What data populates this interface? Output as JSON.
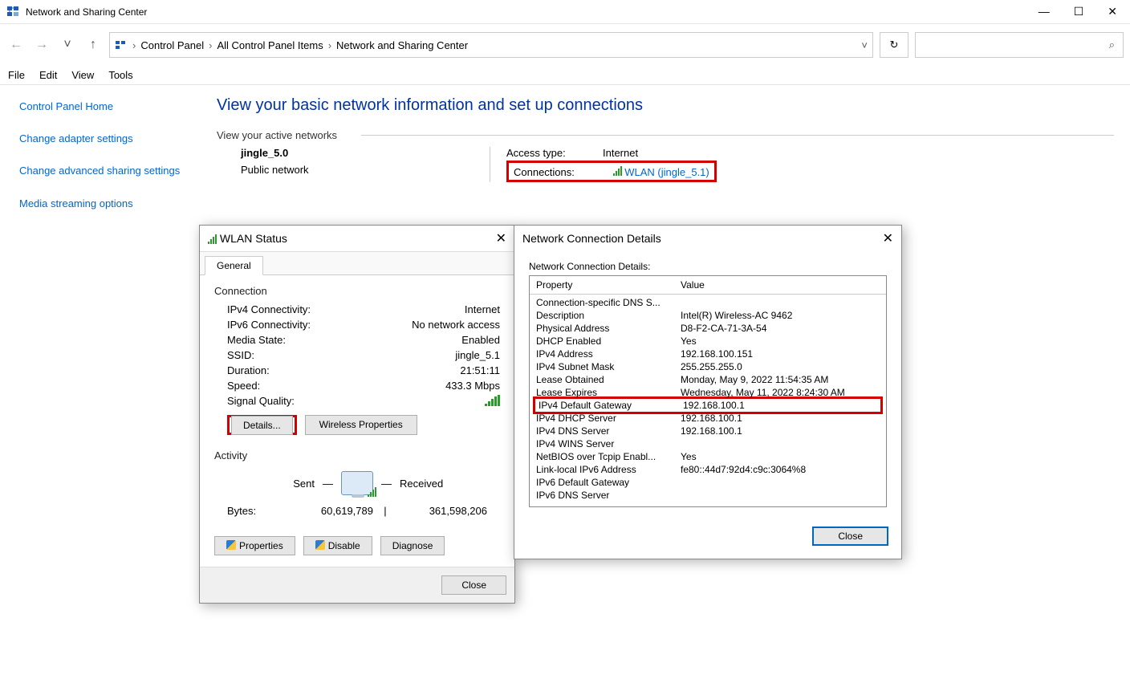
{
  "window": {
    "title": "Network and Sharing Center"
  },
  "breadcrumb": {
    "b1": "Control Panel",
    "b2": "All Control Panel Items",
    "b3": "Network and Sharing Center"
  },
  "menu": {
    "file": "File",
    "edit": "Edit",
    "view": "View",
    "tools": "Tools"
  },
  "sidebar": {
    "home": "Control Panel Home",
    "adapter": "Change adapter settings",
    "sharing": "Change advanced sharing settings",
    "media": "Media streaming options"
  },
  "main": {
    "header": "View your basic network information and set up connections",
    "active_label": "View your active networks",
    "network_name": "jingle_5.0",
    "network_type": "Public network",
    "access_label": "Access type:",
    "access_value": "Internet",
    "conn_label": "Connections:",
    "conn_value": "WLAN (jingle_5.1)"
  },
  "status": {
    "title": "WLAN Status",
    "tab": "General",
    "grp1": "Connection",
    "rows": {
      "ipv4c_k": "IPv4 Connectivity:",
      "ipv4c_v": "Internet",
      "ipv6c_k": "IPv6 Connectivity:",
      "ipv6c_v": "No network access",
      "media_k": "Media State:",
      "media_v": "Enabled",
      "ssid_k": "SSID:",
      "ssid_v": "jingle_5.1",
      "dur_k": "Duration:",
      "dur_v": "21:51:11",
      "speed_k": "Speed:",
      "speed_v": "433.3 Mbps",
      "sq_k": "Signal Quality:"
    },
    "details_btn": "Details...",
    "wprops_btn": "Wireless Properties",
    "grp2": "Activity",
    "sent": "Sent",
    "received": "Received",
    "bytes_k": "Bytes:",
    "bytes_s": "60,619,789",
    "bytes_r": "361,598,206",
    "props": "Properties",
    "disable": "Disable",
    "diag": "Diagnose",
    "close": "Close"
  },
  "details": {
    "title": "Network Connection Details",
    "label": "Network Connection Details:",
    "col1": "Property",
    "col2": "Value",
    "rows": [
      {
        "p": "Connection-specific DNS S...",
        "v": ""
      },
      {
        "p": "Description",
        "v": "Intel(R) Wireless-AC 9462"
      },
      {
        "p": "Physical Address",
        "v": "D8-F2-CA-71-3A-54"
      },
      {
        "p": "DHCP Enabled",
        "v": "Yes"
      },
      {
        "p": "IPv4 Address",
        "v": "192.168.100.151"
      },
      {
        "p": "IPv4 Subnet Mask",
        "v": "255.255.255.0"
      },
      {
        "p": "Lease Obtained",
        "v": "Monday, May 9, 2022 11:54:35 AM"
      },
      {
        "p": "Lease Expires",
        "v": "Wednesday, May 11, 2022 8:24:30 AM"
      },
      {
        "p": "IPv4 Default Gateway",
        "v": "192.168.100.1",
        "hl": true
      },
      {
        "p": "IPv4 DHCP Server",
        "v": "192.168.100.1"
      },
      {
        "p": "IPv4 DNS Server",
        "v": "192.168.100.1"
      },
      {
        "p": "IPv4 WINS Server",
        "v": ""
      },
      {
        "p": "NetBIOS over Tcpip Enabl...",
        "v": "Yes"
      },
      {
        "p": "Link-local IPv6 Address",
        "v": "fe80::44d7:92d4:c9c:3064%8"
      },
      {
        "p": "IPv6 Default Gateway",
        "v": ""
      },
      {
        "p": "IPv6 DNS Server",
        "v": ""
      }
    ],
    "close": "Close"
  }
}
